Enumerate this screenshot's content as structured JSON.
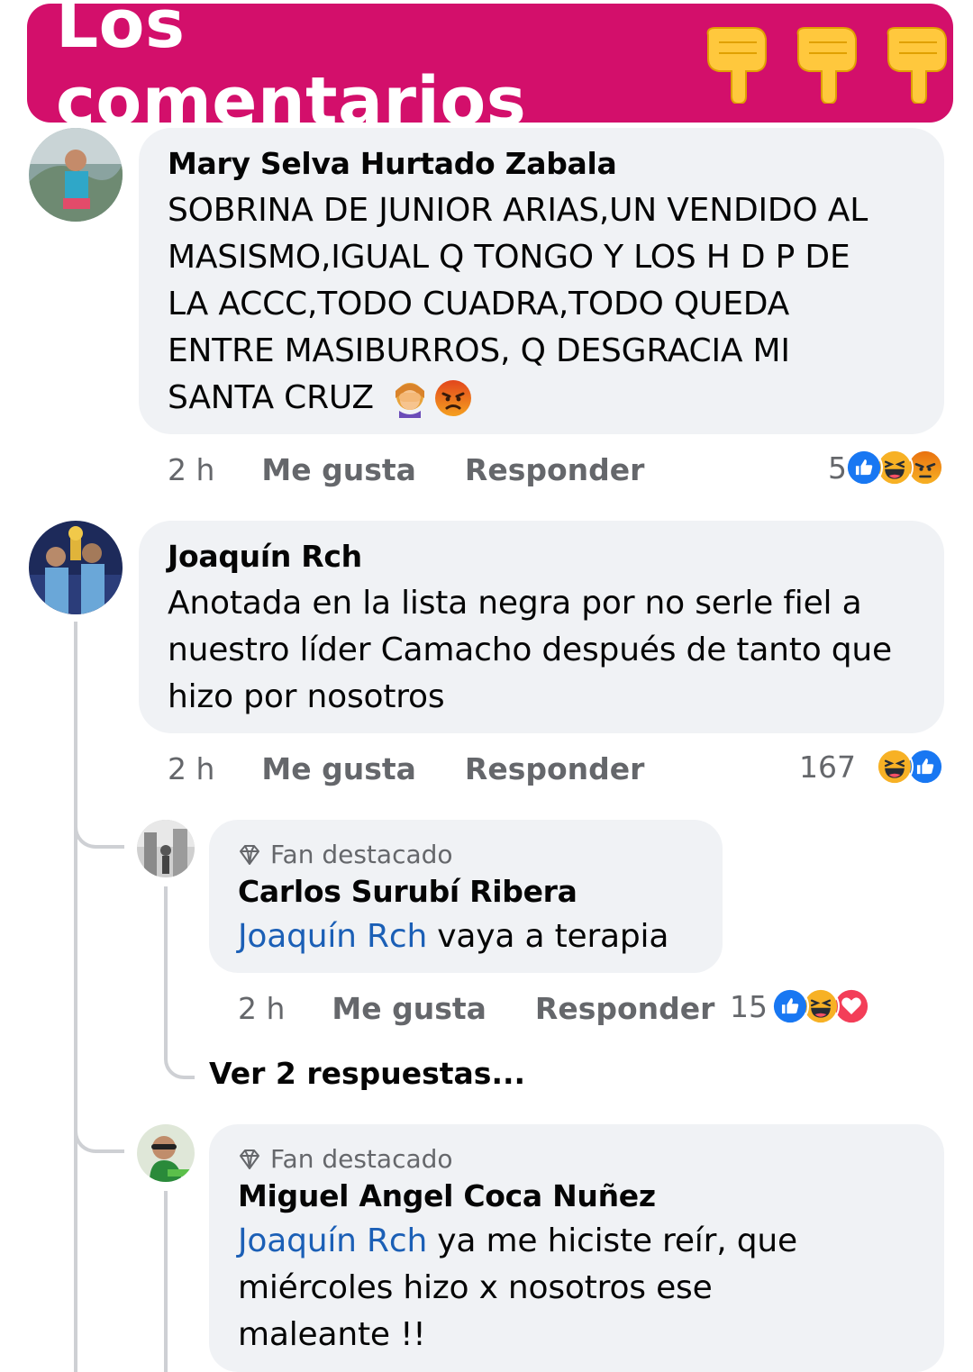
{
  "banner": {
    "title": "Los comentarios",
    "icons": [
      "pointing-down-hand-icon",
      "pointing-down-hand-icon",
      "pointing-down-hand-icon"
    ],
    "background_color": "#d30f6b"
  },
  "comments": [
    {
      "author": "Mary Selva Hurtado Zabala",
      "text_lines": [
        "SOBRINA DE JUNIOR ARIAS,UN VENDIDO AL",
        "MASISMO,IGUAL Q TONGO Y LOS H  D  P DE",
        "LA ACCC,TODO CUADRA,TODO QUEDA",
        "ENTRE MASIBURROS, Q DESGRACIA MI",
        "SANTA CRUZ"
      ],
      "emojis": [
        "facepalm-emoji",
        "angry-face-emoji"
      ],
      "time": "2 h",
      "like_label": "Me gusta",
      "reply_label": "Responder",
      "reaction_count": "5",
      "reactions": [
        "like",
        "haha",
        "angry"
      ]
    },
    {
      "author": "Joaquín Rch",
      "text_lines": [
        "Anotada en la lista negra por no serle fiel a",
        "nuestro líder Camacho después de tanto que",
        "hizo por nosotros"
      ],
      "time": "2 h",
      "like_label": "Me gusta",
      "reply_label": "Responder",
      "reaction_count": "167",
      "reactions": [
        "haha",
        "like"
      ],
      "replies": [
        {
          "badge": "Fan destacado",
          "author": "Carlos Surubí Ribera",
          "mention": "Joaquín Rch",
          "text": " vaya a terapia",
          "time": "2 h",
          "like_label": "Me gusta",
          "reply_label": "Responder",
          "reaction_count": "15",
          "reactions": [
            "like",
            "haha",
            "love"
          ],
          "view_replies": "Ver 2 respuestas..."
        },
        {
          "badge": "Fan destacado",
          "author": "Miguel Angel Coca Nuñez",
          "mention": "Joaquín Rch",
          "text_first": " ya me hiciste reír, que",
          "text_lines": [
            "miércoles hizo x nosotros ese",
            "maleante !!"
          ]
        }
      ]
    }
  ],
  "colors": {
    "like_blue": "#1877f2",
    "haha_yellow": "#f7b125",
    "angry_orange": "#e9710f",
    "love_red": "#f33e58",
    "mention_blue": "#1b5fb6",
    "bubble_gray": "#f0f2f5",
    "meta_gray": "#65676b"
  }
}
